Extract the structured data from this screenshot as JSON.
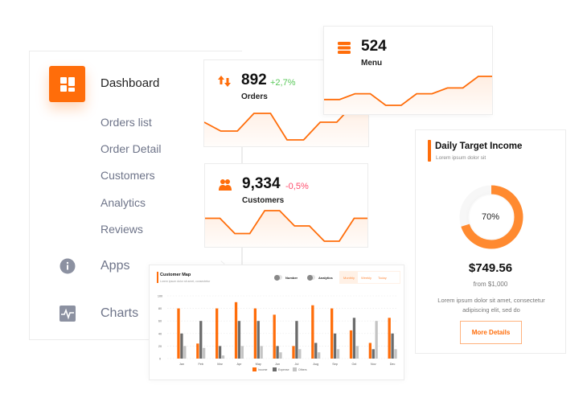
{
  "sidebar": {
    "dashboard_label": "Dashboard",
    "dashboard_icon": "dashboard-grid-icon",
    "sub_items": [
      {
        "label": "Orders list"
      },
      {
        "label": "Order Detail"
      },
      {
        "label": "Customers"
      },
      {
        "label": "Analytics"
      },
      {
        "label": "Reviews"
      }
    ],
    "main_items": [
      {
        "label": "Apps",
        "icon": "info-icon"
      },
      {
        "label": "Charts",
        "icon": "pulse-chart-icon"
      }
    ]
  },
  "cards": {
    "orders": {
      "value": "892",
      "delta": "+2,7%",
      "label": "Orders",
      "icon": "arrows-up-down-icon",
      "trend": [
        3,
        2,
        2,
        4,
        4,
        1,
        1,
        3,
        3,
        5,
        5
      ]
    },
    "menu": {
      "value": "524",
      "label": "Menu",
      "icon": "menu-stack-icon",
      "trend": [
        2,
        2,
        3,
        3,
        1,
        1,
        3,
        3,
        4,
        4,
        6,
        6
      ]
    },
    "customers": {
      "value": "9,334",
      "delta": "-0,5%",
      "label": "Customers",
      "icon": "users-icon",
      "trend": [
        4,
        4,
        2,
        2,
        5,
        5,
        3,
        3,
        1,
        1,
        4,
        4
      ]
    }
  },
  "colors": {
    "accent": "#ff6d0a",
    "positive": "#5ac85a",
    "negative": "#ff4d6d",
    "expense": "#6b6b6b",
    "others": "#c4c4c4"
  },
  "income": {
    "title": "Daily Target Income",
    "subtitle": "Lorem ipsum dolor sit",
    "progress_percent": 70,
    "progress_label": "70%",
    "amount": "$749.56",
    "from": "from $1,000",
    "description": "Lorem ipsum dolor sit amet, consectetur adipiscing elit, sed do",
    "button_label": "More Details"
  },
  "customer_map": {
    "title": "Customer Map",
    "subtitle": "Lorem ipsum dolor sit amet, consectetur",
    "toggles": [
      {
        "label": "Number"
      },
      {
        "label": "Analytics"
      }
    ],
    "tabs": [
      {
        "label": "Monthly",
        "active": true
      },
      {
        "label": "Weekly",
        "active": false
      },
      {
        "label": "Today",
        "active": false
      }
    ]
  },
  "chart_data": {
    "type": "bar",
    "title": "Customer Map",
    "categories": [
      "Jan",
      "Feb",
      "Mar",
      "Apr",
      "May",
      "Jun",
      "Jul",
      "Aug",
      "Sep",
      "Oct",
      "Nov",
      "Dec"
    ],
    "series": [
      {
        "name": "Income",
        "color": "#ff6d0a",
        "values": [
          80,
          24,
          80,
          90,
          80,
          70,
          20,
          85,
          80,
          45,
          25,
          65
        ]
      },
      {
        "name": "Expense",
        "color": "#6b6b6b",
        "values": [
          40,
          60,
          20,
          60,
          60,
          20,
          60,
          25,
          40,
          65,
          15,
          40
        ]
      },
      {
        "name": "Others",
        "color": "#c4c4c4",
        "values": [
          20,
          17,
          5,
          20,
          20,
          10,
          15,
          10,
          15,
          20,
          60,
          15
        ]
      }
    ],
    "yticks": [
      "0",
      "20",
      "40",
      "60",
      "80",
      "100"
    ],
    "ylim": [
      0,
      100
    ],
    "grid": true,
    "legend_position": "bottom-center",
    "xlabel": "",
    "ylabel": ""
  }
}
